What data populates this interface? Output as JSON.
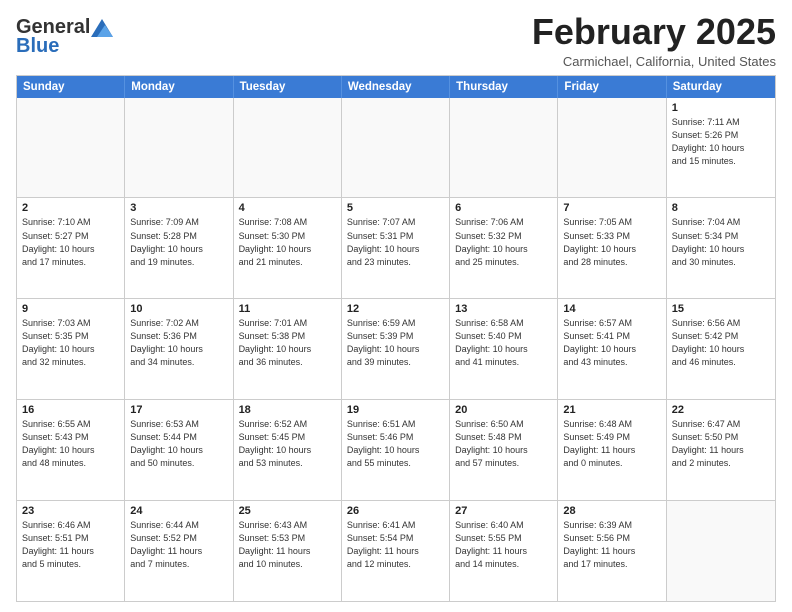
{
  "header": {
    "logo_general": "General",
    "logo_blue": "Blue",
    "month_title": "February 2025",
    "location": "Carmichael, California, United States"
  },
  "calendar": {
    "days_of_week": [
      "Sunday",
      "Monday",
      "Tuesday",
      "Wednesday",
      "Thursday",
      "Friday",
      "Saturday"
    ],
    "weeks": [
      [
        {
          "day": "",
          "detail": ""
        },
        {
          "day": "",
          "detail": ""
        },
        {
          "day": "",
          "detail": ""
        },
        {
          "day": "",
          "detail": ""
        },
        {
          "day": "",
          "detail": ""
        },
        {
          "day": "",
          "detail": ""
        },
        {
          "day": "1",
          "detail": "Sunrise: 7:11 AM\nSunset: 5:26 PM\nDaylight: 10 hours\nand 15 minutes."
        }
      ],
      [
        {
          "day": "2",
          "detail": "Sunrise: 7:10 AM\nSunset: 5:27 PM\nDaylight: 10 hours\nand 17 minutes."
        },
        {
          "day": "3",
          "detail": "Sunrise: 7:09 AM\nSunset: 5:28 PM\nDaylight: 10 hours\nand 19 minutes."
        },
        {
          "day": "4",
          "detail": "Sunrise: 7:08 AM\nSunset: 5:30 PM\nDaylight: 10 hours\nand 21 minutes."
        },
        {
          "day": "5",
          "detail": "Sunrise: 7:07 AM\nSunset: 5:31 PM\nDaylight: 10 hours\nand 23 minutes."
        },
        {
          "day": "6",
          "detail": "Sunrise: 7:06 AM\nSunset: 5:32 PM\nDaylight: 10 hours\nand 25 minutes."
        },
        {
          "day": "7",
          "detail": "Sunrise: 7:05 AM\nSunset: 5:33 PM\nDaylight: 10 hours\nand 28 minutes."
        },
        {
          "day": "8",
          "detail": "Sunrise: 7:04 AM\nSunset: 5:34 PM\nDaylight: 10 hours\nand 30 minutes."
        }
      ],
      [
        {
          "day": "9",
          "detail": "Sunrise: 7:03 AM\nSunset: 5:35 PM\nDaylight: 10 hours\nand 32 minutes."
        },
        {
          "day": "10",
          "detail": "Sunrise: 7:02 AM\nSunset: 5:36 PM\nDaylight: 10 hours\nand 34 minutes."
        },
        {
          "day": "11",
          "detail": "Sunrise: 7:01 AM\nSunset: 5:38 PM\nDaylight: 10 hours\nand 36 minutes."
        },
        {
          "day": "12",
          "detail": "Sunrise: 6:59 AM\nSunset: 5:39 PM\nDaylight: 10 hours\nand 39 minutes."
        },
        {
          "day": "13",
          "detail": "Sunrise: 6:58 AM\nSunset: 5:40 PM\nDaylight: 10 hours\nand 41 minutes."
        },
        {
          "day": "14",
          "detail": "Sunrise: 6:57 AM\nSunset: 5:41 PM\nDaylight: 10 hours\nand 43 minutes."
        },
        {
          "day": "15",
          "detail": "Sunrise: 6:56 AM\nSunset: 5:42 PM\nDaylight: 10 hours\nand 46 minutes."
        }
      ],
      [
        {
          "day": "16",
          "detail": "Sunrise: 6:55 AM\nSunset: 5:43 PM\nDaylight: 10 hours\nand 48 minutes."
        },
        {
          "day": "17",
          "detail": "Sunrise: 6:53 AM\nSunset: 5:44 PM\nDaylight: 10 hours\nand 50 minutes."
        },
        {
          "day": "18",
          "detail": "Sunrise: 6:52 AM\nSunset: 5:45 PM\nDaylight: 10 hours\nand 53 minutes."
        },
        {
          "day": "19",
          "detail": "Sunrise: 6:51 AM\nSunset: 5:46 PM\nDaylight: 10 hours\nand 55 minutes."
        },
        {
          "day": "20",
          "detail": "Sunrise: 6:50 AM\nSunset: 5:48 PM\nDaylight: 10 hours\nand 57 minutes."
        },
        {
          "day": "21",
          "detail": "Sunrise: 6:48 AM\nSunset: 5:49 PM\nDaylight: 11 hours\nand 0 minutes."
        },
        {
          "day": "22",
          "detail": "Sunrise: 6:47 AM\nSunset: 5:50 PM\nDaylight: 11 hours\nand 2 minutes."
        }
      ],
      [
        {
          "day": "23",
          "detail": "Sunrise: 6:46 AM\nSunset: 5:51 PM\nDaylight: 11 hours\nand 5 minutes."
        },
        {
          "day": "24",
          "detail": "Sunrise: 6:44 AM\nSunset: 5:52 PM\nDaylight: 11 hours\nand 7 minutes."
        },
        {
          "day": "25",
          "detail": "Sunrise: 6:43 AM\nSunset: 5:53 PM\nDaylight: 11 hours\nand 10 minutes."
        },
        {
          "day": "26",
          "detail": "Sunrise: 6:41 AM\nSunset: 5:54 PM\nDaylight: 11 hours\nand 12 minutes."
        },
        {
          "day": "27",
          "detail": "Sunrise: 6:40 AM\nSunset: 5:55 PM\nDaylight: 11 hours\nand 14 minutes."
        },
        {
          "day": "28",
          "detail": "Sunrise: 6:39 AM\nSunset: 5:56 PM\nDaylight: 11 hours\nand 17 minutes."
        },
        {
          "day": "",
          "detail": ""
        }
      ]
    ]
  }
}
